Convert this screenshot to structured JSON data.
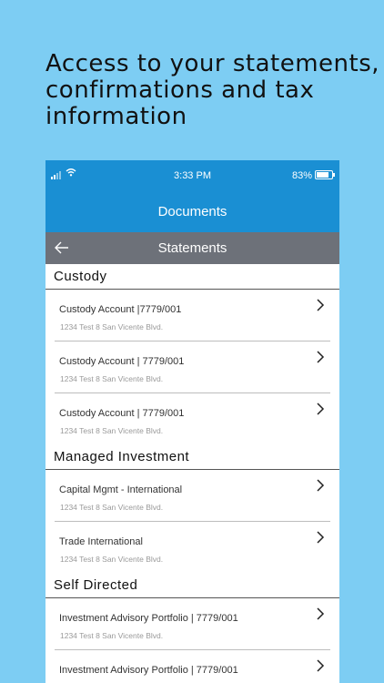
{
  "headline": {
    "line1": "Access to your statements,",
    "line2": "confirmations and tax",
    "line3": "information"
  },
  "status_bar": {
    "time": "3:33 PM",
    "battery_text": "83%",
    "battery_level": 0.83,
    "wifi_icon": "wifi-icon",
    "signal_icon": "signal-bars-icon"
  },
  "app_bar": {
    "title": "Documents"
  },
  "sub_bar": {
    "title": "Statements",
    "back_icon": "back-arrow-icon"
  },
  "sections": [
    {
      "title": "Custody",
      "items": [
        {
          "title": "Custody Account |7779/001",
          "address": "1234 Test 8  San Vicente Blvd."
        },
        {
          "title": "Custody Account | 7779/001",
          "address": "1234 Test 8  San Vicente Blvd."
        },
        {
          "title": "Custody Account | 7779/001",
          "address": "1234 Test 8  San Vicente Blvd."
        }
      ]
    },
    {
      "title": "Managed Investment",
      "items": [
        {
          "title": "Capital Mgmt - International",
          "address": "1234 Test 8  San Vicente Blvd."
        },
        {
          "title": "Trade  International",
          "address": "1234 Test 8  San Vicente Blvd."
        }
      ]
    },
    {
      "title": "Self Directed",
      "items": [
        {
          "title": "Investment Advisory Portfolio | 7779/001",
          "address": "1234 Test 8  San Vicente Blvd."
        },
        {
          "title": "Investment Advisory Portfolio | 7779/001",
          "address": ""
        }
      ]
    }
  ],
  "colors": {
    "background": "#7dcdf3",
    "app_bar": "#1a8fd3",
    "sub_bar": "#6d7179"
  }
}
